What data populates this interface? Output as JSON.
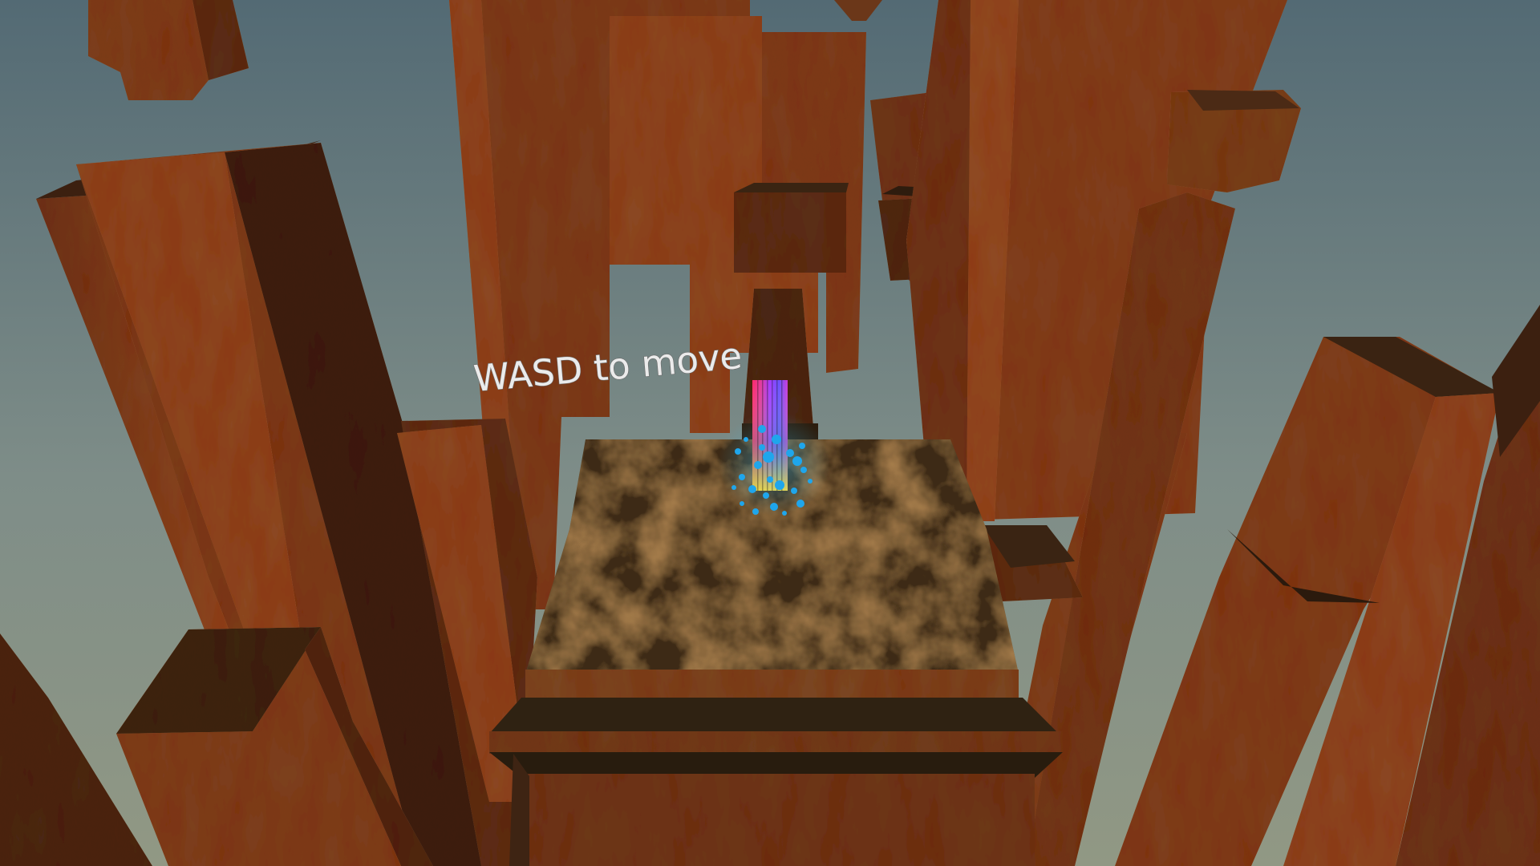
{
  "hint": {
    "text": "WASD to move"
  },
  "colors": {
    "sky_top": "#536a74",
    "sky_bottom": "#8e9787",
    "rust_light": "#8f4a23",
    "rust_dark": "#3b2414",
    "platform_top": "#3f2c18",
    "player_beam_left": "#e0228a",
    "player_beam_right": "#9f2cff",
    "particles": "#1ea8ee"
  }
}
